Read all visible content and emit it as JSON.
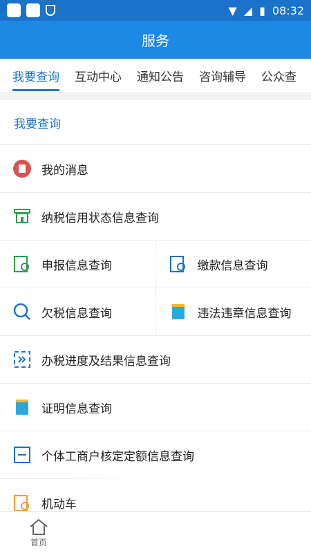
{
  "status": {
    "time": "08:32"
  },
  "title": "服务",
  "tabs": [
    {
      "label": "我要查询",
      "active": true
    },
    {
      "label": "互动中心"
    },
    {
      "label": "通知公告"
    },
    {
      "label": "咨询辅导"
    },
    {
      "label": "公众查"
    }
  ],
  "section": {
    "title": "我要查询"
  },
  "items": {
    "messages": "我的消息",
    "credit": "纳税信用状态信息查询",
    "declare": "申报信息查询",
    "payment": "缴款信息查询",
    "arrears": "欠税信息查询",
    "violation": "违法违章信息查询",
    "progress": "办税进度及结果信息查询",
    "certificate": "证明信息查询",
    "individual": "个体工商户核定定额信息查询",
    "vehicle": "机动车"
  },
  "nav": {
    "home": "首页"
  },
  "colors": {
    "primary": "#1e88e5",
    "status_bar": "#1a73c9",
    "accent": "#1a73c9"
  }
}
